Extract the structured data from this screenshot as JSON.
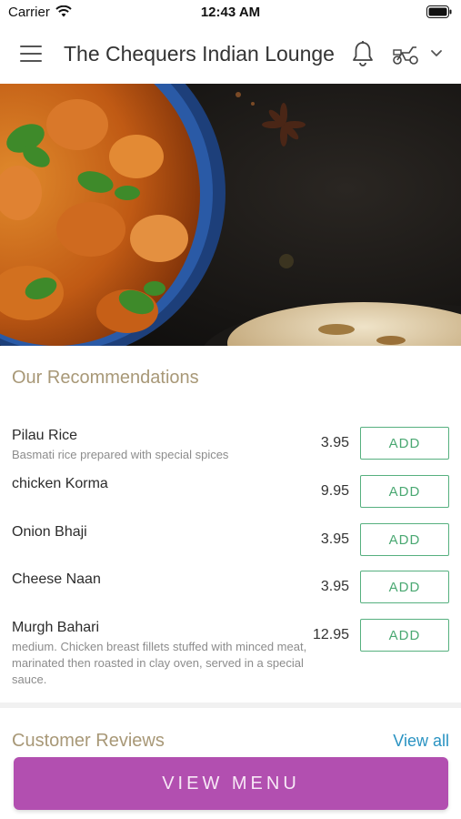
{
  "status_bar": {
    "carrier": "Carrier",
    "time": "12:43 AM",
    "icons": [
      "wifi-icon",
      "battery-icon"
    ]
  },
  "header": {
    "title": "The Chequers Indian Lounge",
    "icons": [
      "menu-icon",
      "bell-icon",
      "scooter-icon",
      "chevron-down-icon"
    ]
  },
  "recommendations": {
    "title": "Our Recommendations",
    "add_label": "ADD",
    "items": [
      {
        "name": "Pilau Rice",
        "description": "Basmati rice prepared with special spices",
        "price": "3.95"
      },
      {
        "name": "chicken Korma",
        "description": "",
        "price": "9.95"
      },
      {
        "name": "Onion Bhaji",
        "description": "",
        "price": "3.95"
      },
      {
        "name": "Cheese Naan",
        "description": "",
        "price": "3.95"
      },
      {
        "name": "Murgh Bahari",
        "description": "medium. Chicken breast fillets stuffed with minced meat, marinated then roasted in clay oven, served in a special sauce.",
        "price": "12.95"
      }
    ]
  },
  "reviews": {
    "title": "Customer Reviews",
    "view_all": "View all"
  },
  "footer": {
    "view_menu": "VIEW MENU"
  },
  "colors": {
    "accent_gold": "#a89877",
    "add_green": "#4aa872",
    "link_blue": "#2a93c2",
    "button_purple": "#b24fb0"
  }
}
